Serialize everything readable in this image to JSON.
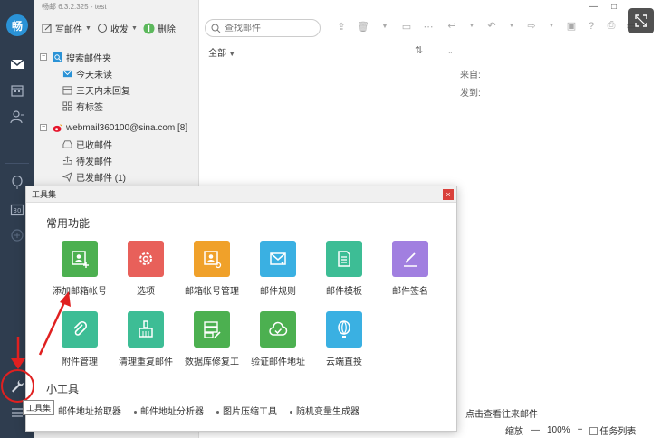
{
  "app": {
    "title_bar": "畅邮 6.3.2.325 - test",
    "avatar_label": "畅"
  },
  "toolbar": {
    "compose_label": "写邮件",
    "receive_label": "收发",
    "delete_label": "删除"
  },
  "folders": {
    "search_root": "搜索邮件夹",
    "search_items": [
      "今天未读",
      "三天内未回复",
      "有标签"
    ],
    "account": "webmail360100@sina.com [8]",
    "account_items": [
      "已收邮件",
      "待发邮件",
      "已发邮件 (1)"
    ]
  },
  "list": {
    "search_placeholder": "查找邮件",
    "filter_label": "全部",
    "sort_icon": "sort-icon"
  },
  "reader": {
    "from_label": "来自:",
    "to_label": "发到:",
    "bottom_text": "点击查看往来邮件",
    "zoom_label": "缩放",
    "zoom_minus": "—",
    "zoom_value": "100%",
    "zoom_plus": "+",
    "task_list_label": "任务列表"
  },
  "window": {
    "minimize": "—",
    "maximize": "□"
  },
  "dialog": {
    "title": "工具集",
    "close": "×",
    "common_title": "常用功能",
    "tools_title": "小工具",
    "common_items": [
      {
        "label": "添加邮箱帐号",
        "color": "#4cb050",
        "icon": "add-account-icon"
      },
      {
        "label": "选项",
        "color": "#e8605a",
        "icon": "gear-icon"
      },
      {
        "label": "邮箱帐号管理",
        "color": "#f0a12a",
        "icon": "account-manage-icon"
      },
      {
        "label": "邮件规则",
        "color": "#3ab0e2",
        "icon": "mail-rule-icon"
      },
      {
        "label": "邮件模板",
        "color": "#3dbd95",
        "icon": "template-icon"
      },
      {
        "label": "邮件签名",
        "color": "#a17fe0",
        "icon": "signature-icon"
      },
      {
        "label": "附件管理",
        "color": "#3dbd95",
        "icon": "paperclip-icon"
      },
      {
        "label": "清理重复邮件",
        "color": "#3dbd95",
        "icon": "broom-icon"
      },
      {
        "label": "数据库修复工",
        "color": "#4cb050",
        "icon": "database-repair-icon"
      },
      {
        "label": "验证邮件地址",
        "color": "#4cb050",
        "icon": "cloud-check-icon"
      },
      {
        "label": "云端直投",
        "color": "#3ab0e2",
        "icon": "balloon-icon"
      }
    ],
    "small_tools": [
      "邮件地址拾取器",
      "邮件地址分析器",
      "图片压缩工具",
      "随机变量生成器"
    ]
  },
  "tooltip": "工具集",
  "colors": {
    "rail": "#2f3d4f",
    "accent_blue": "#2a92d6",
    "annotation_red": "#e02020"
  }
}
